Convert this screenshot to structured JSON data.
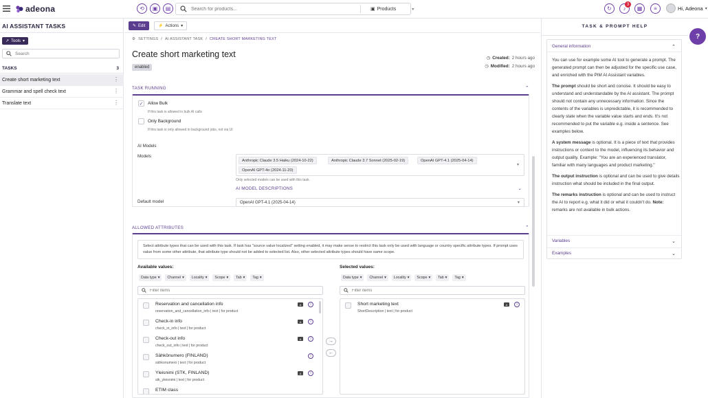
{
  "app": {
    "name": "adeona"
  },
  "topbar": {
    "search_placeholder": "Search for products...",
    "search_scope": "Products",
    "notification_count": "3",
    "user_greeting": "Hi, Adeona"
  },
  "left": {
    "title": "AI ASSISTANT TASKS",
    "tools_label": "Tools",
    "search_placeholder": "Search",
    "tasks_header": "TASKS",
    "tasks_count": "3",
    "tasks": [
      {
        "label": "Create short marketing text"
      },
      {
        "label": "Grammar and spell check text"
      },
      {
        "label": "Translate text"
      }
    ]
  },
  "actionbar": {
    "edit": "Edit",
    "actions": "Actions"
  },
  "breadcrumb": [
    "SETTINGS",
    "AI ASSISTANT TASK",
    "CREATE SHORT MARKETING TEXT"
  ],
  "page": {
    "title": "Create short marketing text",
    "status": "enabled",
    "created_label": "Created:",
    "created_value": "2 hours ago",
    "modified_label": "Modified:",
    "modified_value": "2 hours ago"
  },
  "task_running": {
    "header": "TASK RUNNING",
    "allow_bulk": "Allow Bulk",
    "allow_bulk_checked": true,
    "allow_bulk_hint": "If this task is allowed in bulk AI calls",
    "only_background": "Only Background",
    "only_background_hint": "If this task is only allowed in background jobs, not via UI",
    "ai_models_title": "AI Models",
    "models_label": "Models",
    "models": [
      "Anthropic Claude 3.5 Haiku (2024-10-22)",
      "Anthropic Claude 3.7 Sonnet (2025-02-19)",
      "OpenAI GPT-4.1 (2025-04-14)",
      "OpenAI GPT-4o (2024-11-20)"
    ],
    "models_hint": "Only selected models can be used with this task.",
    "model_descriptions": "AI MODEL DESCRIPTIONS",
    "default_model_label": "Default model",
    "default_model_value": "OpenAI GPT-4.1 (2025-04-14)"
  },
  "allowed_attributes": {
    "header": "ALLOWED ATTRIBUTES",
    "description": "Select attribute types that can be used with this task. If task has \"source value localized\" setting enabled, it may make sense to restrict this task only be used with language or country specific attribute types. If prompt uses value from some other attribute, that attribute type should not be added to selected list. Also, other selected attribute types should have same scope.",
    "available_title": "Available values:",
    "selected_title": "Selected values:",
    "filters": [
      "Data type",
      "Channel",
      "Locality",
      "Scope",
      "Tab",
      "Tag"
    ],
    "filter_placeholder": "Filter items",
    "available": [
      {
        "name": "Reservation and cancellation info",
        "sub": "reservation_and_cancellation_info | text | for product",
        "localized": true
      },
      {
        "name": "Check-in info",
        "sub": "check_in_info | text | for product",
        "localized": true
      },
      {
        "name": "Check-out info",
        "sub": "check_out_info | text | for product",
        "localized": true
      },
      {
        "name": "Sähkönumero (FINLAND)",
        "sub": "sähkonumero | text | for product",
        "localized": false
      },
      {
        "name": "Yleisnimi (STK, FINLAND)",
        "sub": "stk_yleisnimi | text | for product",
        "localized": true
      },
      {
        "name": "ETIM class",
        "sub": "",
        "localized": false
      }
    ],
    "selected": [
      {
        "name": "Short marketing text",
        "sub": "ShortDescription | text | for product",
        "localized": true
      }
    ]
  },
  "help": {
    "title": "TASK & PROMPT HELP",
    "general_label": "General information",
    "p1": "You can use for example some AI tool to generate a prompt. The generated prompt can then be adjusted for the specific use case, and enriched with the PIM AI Assistant variables.",
    "p2_bold": "The prompt",
    "p2": " should be short and concise. It should be easy to understand and understandable by the AI assistant. The prompt should not contain any unnecessary information. Since the contents of the variables is unpredictable, it is recommended to clearly state when the variable value starts and ends. It's not recommended to put the variable e.g. inside a sentence. See examples below.",
    "p3_bold": "A system message",
    "p3": " is optional. It is a piece of text that provides instructions or context to the model, influencing its behavior and output quality. Example: \"You are an experienced translator, familiar with many languages and product marketing.\"",
    "p4_bold": "The output instruction",
    "p4": " is optional and can be used to give details instruction what should be included in the final output.",
    "p5_bold": "The remarks instruction",
    "p5": " is optional and can be used to instruct the AI to report e.g. what it did or what it couldn't do. ",
    "p5_note_bold": "Note:",
    "p5_note": " remarks are not available in bulk actions.",
    "variables_label": "Variables",
    "examples_label": "Examples"
  },
  "colors": {
    "accent": "#5b3d8f",
    "brand": "#6e3fa8",
    "badge": "#d9233d"
  }
}
